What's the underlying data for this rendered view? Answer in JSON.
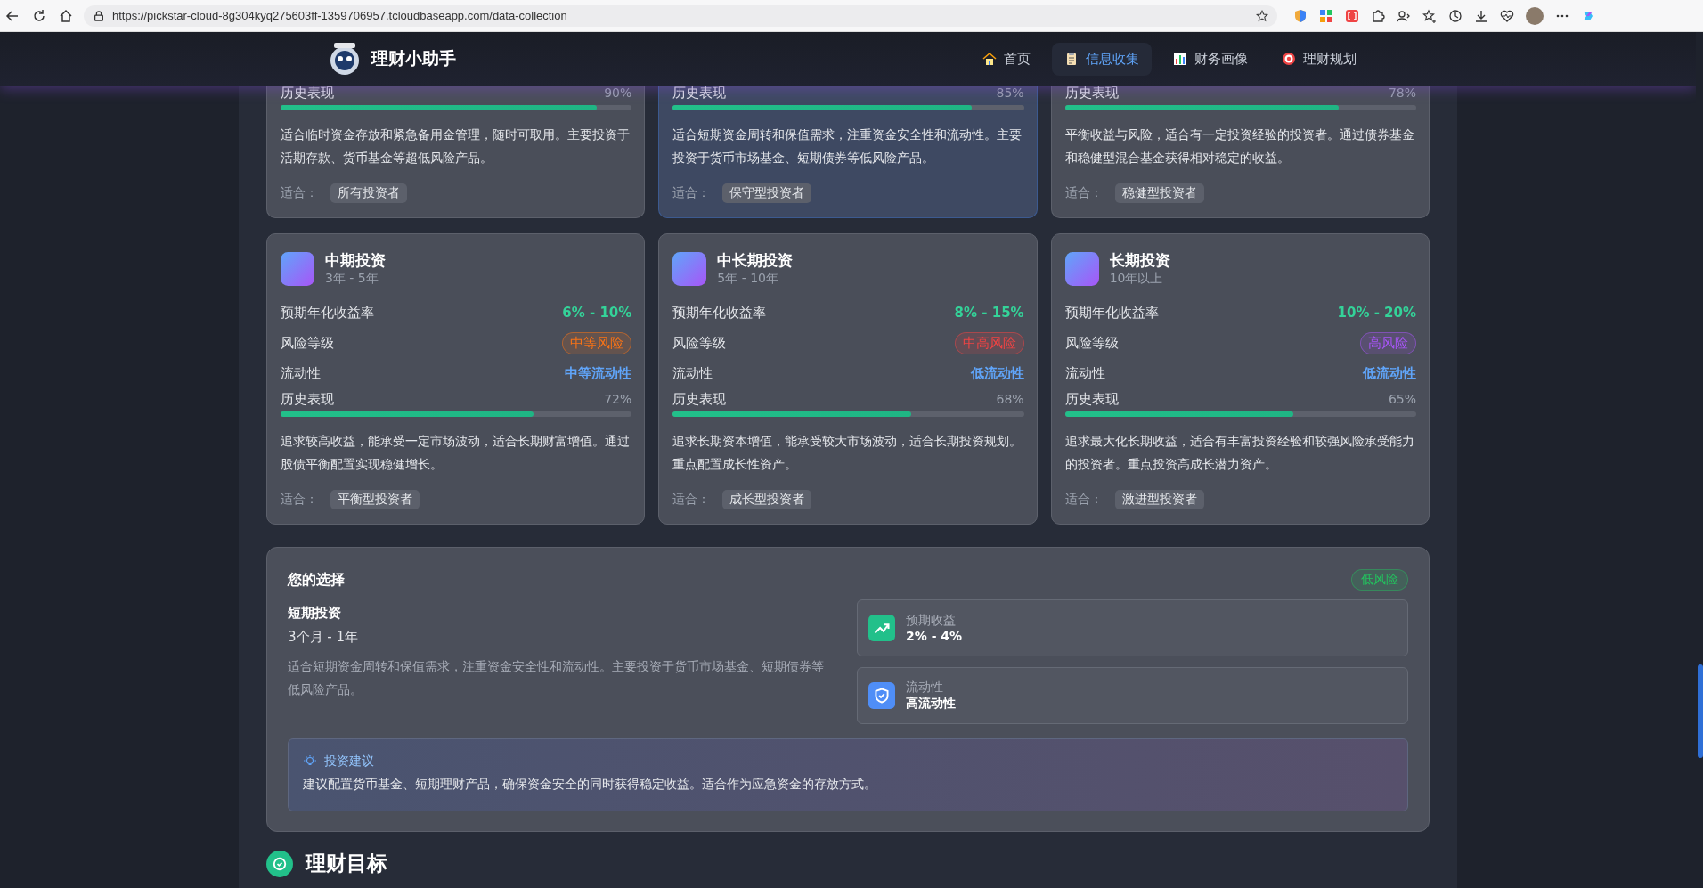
{
  "browser": {
    "url": "https://pickstar-cloud-8g304kyq275603ff-1359706957.tcloudbaseapp.com/data-collection"
  },
  "header": {
    "app_title": "理财小助手",
    "nav": [
      {
        "label": "首页",
        "selected": false
      },
      {
        "label": "信息收集",
        "selected": true
      },
      {
        "label": "财务画像",
        "selected": false
      },
      {
        "label": "理财规划",
        "selected": false
      }
    ]
  },
  "plans": [
    {
      "selected": false,
      "history_label": "历史表现",
      "history_value": "90%",
      "level": 0.9,
      "description": "适合临时资金存放和紧急备用金管理，随时可取用。主要投资于活期存款、货币基金等超低风险产品。",
      "suit_label": "适合：",
      "suit": "所有投资者"
    },
    {
      "selected": true,
      "history_label": "历史表现",
      "history_value": "85%",
      "level": 0.85,
      "description": "适合短期资金周转和保值需求，注重资金安全性和流动性。主要投资于货币市场基金、短期债券等低风险产品。",
      "suit_label": "适合：",
      "suit": "保守型投资者"
    },
    {
      "selected": false,
      "history_label": "历史表现",
      "history_value": "78%",
      "level": 0.78,
      "description": "平衡收益与风险，适合有一定投资经验的投资者。通过债券基金和稳健型混合基金获得相对稳定的收益。",
      "suit_label": "适合：",
      "suit": "稳健型投资者"
    },
    {
      "selected": false,
      "title": "中期投资",
      "period": "3年 - 5年",
      "rows": [
        {
          "kind": "return",
          "label": "预期年化收益率",
          "value": "6% - 10%"
        },
        {
          "kind": "risk",
          "label": "风险等级",
          "value": "中等风险",
          "color": "#f97316"
        },
        {
          "kind": "liquidity",
          "label": "流动性",
          "value": "中等流动性"
        }
      ],
      "history_label": "历史表现",
      "history_value": "72%",
      "level": 0.72,
      "description": "追求较高收益，能承受一定市场波动，适合长期财富增值。通过股债平衡配置实现稳健增长。",
      "suit_label": "适合：",
      "suit": "平衡型投资者"
    },
    {
      "selected": false,
      "title": "中长期投资",
      "period": "5年 - 10年",
      "rows": [
        {
          "kind": "return",
          "label": "预期年化收益率",
          "value": "8% - 15%"
        },
        {
          "kind": "risk",
          "label": "风险等级",
          "value": "中高风险",
          "color": "#ef4444"
        },
        {
          "kind": "liquidity",
          "label": "流动性",
          "value": "低流动性"
        }
      ],
      "history_label": "历史表现",
      "history_value": "68%",
      "level": 0.68,
      "description": "追求长期资本增值，能承受较大市场波动，适合长期投资规划。重点配置成长性资产。",
      "suit_label": "适合：",
      "suit": "成长型投资者"
    },
    {
      "selected": false,
      "title": "长期投资",
      "period": "10年以上",
      "rows": [
        {
          "kind": "return",
          "label": "预期年化收益率",
          "value": "10% - 20%"
        },
        {
          "kind": "risk",
          "label": "风险等级",
          "value": "高风险",
          "color": "#a855f7"
        },
        {
          "kind": "liquidity",
          "label": "流动性",
          "value": "低流动性"
        }
      ],
      "history_label": "历史表现",
      "history_value": "65%",
      "level": 0.65,
      "description": "追求最大化长期收益，适合有丰富投资经验和较强风险承受能力的投资者。重点投资高成长潜力资产。",
      "suit_label": "适合：",
      "suit": "激进型投资者"
    }
  ],
  "selection": {
    "title": "您的选择",
    "badge": {
      "text": "低风险",
      "color": "#22c55e"
    },
    "name": "短期投资",
    "period": "3个月 - 1年",
    "description": "适合短期资金周转和保值需求，注重资金安全性和流动性。主要投资于货币市场基金、短期债券等低风险产品。",
    "stats": [
      {
        "kind": "return",
        "label": "预期收益",
        "value": "2% - 4%"
      },
      {
        "kind": "liquidity",
        "label": "流动性",
        "value": "高流动性"
      }
    ],
    "advice": {
      "title": "投资建议",
      "text": "建议配置货币基金、短期理财产品，确保资金安全的同时获得稳定收益。适合作为应急资金的存放方式。"
    }
  },
  "next_section": {
    "title": "理财目标"
  }
}
